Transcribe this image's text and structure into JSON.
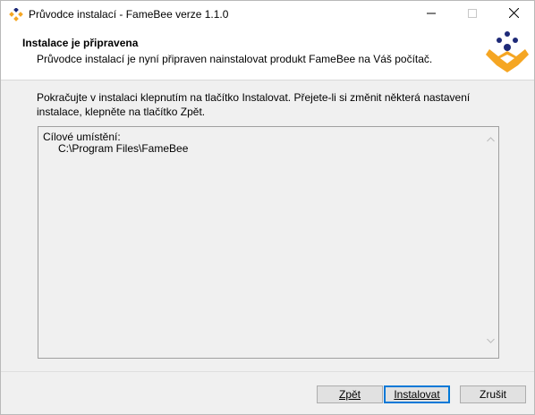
{
  "window": {
    "title": "Průvodce instalací - FameBee verze 1.1.0"
  },
  "header": {
    "title": "Instalace je připravena",
    "subtitle": "Průvodce instalací je nyní připraven nainstalovat produkt FameBee na Váš počítač."
  },
  "content": {
    "instructions": "Pokračujte v instalaci klepnutím na tlačítko Instalovat. Přejete-li si změnit některá nastavení instalace, klepněte na tlačítko Zpět.",
    "memo_lines": [
      "Cílové umístění:",
      "C:\\Program Files\\FameBee"
    ]
  },
  "buttons": {
    "back_label": "Zpět",
    "install_label": "Instalovat",
    "cancel_label": "Zrušit"
  },
  "colors": {
    "logo_navy": "#1e2a78",
    "logo_yellow": "#f5a623",
    "focus_blue": "#0078d7"
  }
}
